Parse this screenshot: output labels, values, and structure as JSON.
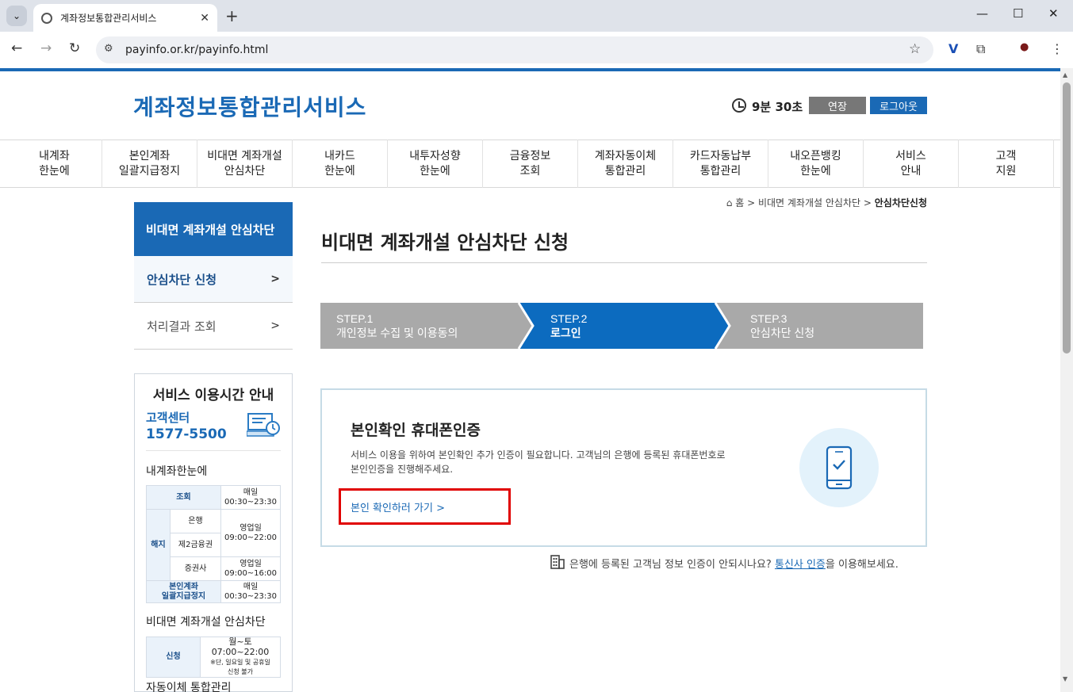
{
  "browser": {
    "tab_title": "계좌정보통합관리서비스",
    "url": "payinfo.or.kr/payinfo.html"
  },
  "header": {
    "logo": "계좌정보통합관리서비스",
    "timer": "9분 30초",
    "extend_label": "연장",
    "logout_label": "로그아웃"
  },
  "gnb": [
    {
      "line1": "내계좌",
      "line2": "한눈에"
    },
    {
      "line1": "본인계좌",
      "line2": "일괄지급정지"
    },
    {
      "line1": "비대면 계좌개설",
      "line2": "안심차단"
    },
    {
      "line1": "내카드",
      "line2": "한눈에"
    },
    {
      "line1": "내투자성향",
      "line2": "한눈에"
    },
    {
      "line1": "금융정보",
      "line2": "조회"
    },
    {
      "line1": "계좌자동이체",
      "line2": "통합관리"
    },
    {
      "line1": "카드자동납부",
      "line2": "통합관리"
    },
    {
      "line1": "내오픈뱅킹",
      "line2": "한눈에"
    },
    {
      "line1": "서비스",
      "line2": "안내"
    },
    {
      "line1": "고객",
      "line2": "지원"
    }
  ],
  "lnb": {
    "title": "비대면 계좌개설 안심차단",
    "items": [
      "안심차단 신청",
      "처리결과 조회"
    ]
  },
  "service_hours": {
    "title": "서비스 이용시간 안내",
    "center_label": "고객센터",
    "center_number": "1577-5500",
    "section1": "내계좌한눈에",
    "t1": {
      "inquiry": "조회",
      "daily": "매일",
      "inquiry_time": "00:30~23:30",
      "cancel": "해지",
      "bank": "은행",
      "fin2": "제2금융권",
      "securities": "증권사",
      "bizday": "영업일",
      "bank_time": "09:00~22:00",
      "sec_time": "09:00~16:00",
      "stop1": "본인계좌",
      "stop2": "일괄지급정지",
      "stop_time": "00:30~23:30"
    },
    "section2": "비대면 계좌개설 안심차단",
    "t2": {
      "apply": "신청",
      "time": "월~토 07:00~22:00",
      "note1": "※단, 일요일 및 공휴일",
      "note2": "신청 불가"
    },
    "section3": "자동이체 통합관리"
  },
  "breadcrumb": {
    "home": "홈",
    "level1": "비대면 계좌개설 안심차단",
    "current": "안심차단신청"
  },
  "page_title": "비대면 계좌개설 안심차단 신청",
  "steps": [
    {
      "num": "STEP.1",
      "label": "개인정보 수집 및 이용동의"
    },
    {
      "num": "STEP.2",
      "label": "로그인"
    },
    {
      "num": "STEP.3",
      "label": "안심차단 신청"
    }
  ],
  "auth": {
    "title": "본인확인 휴대폰인증",
    "desc_line1": "서비스 이용을 위하여 본인확인 추가 인증이 필요합니다. 고객님의 은행에 등록된 휴대폰번호로",
    "desc_line2": "본인인증을 진행해주세요.",
    "link": "본인 확인하러 가기"
  },
  "notice": {
    "before": "은행에 등록된 고객님 정보 인증이 안되시나요?",
    "link": "통신사 인증",
    "after": "을 이용해보세요."
  },
  "colors": {
    "brand": "#1a69b5",
    "step_active": "#0c6bbf",
    "step_inactive": "#a9a9a9",
    "highlight": "#e00000"
  }
}
